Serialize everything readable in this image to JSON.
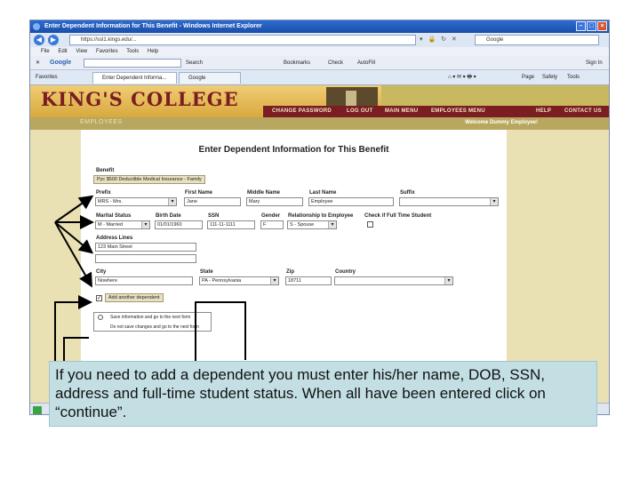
{
  "browser": {
    "window_title": "Enter Dependent Information for This Benefit - Windows Internet Explorer",
    "url": "https://ssl1.kings.edu/...",
    "search_engine": "Google",
    "menu": [
      "File",
      "Edit",
      "View",
      "Favorites",
      "Tools",
      "Help"
    ],
    "gtoolbar": {
      "logo": "Google",
      "search_label": "Search",
      "bookmarks": "Bookmarks",
      "check": "Check",
      "autofill": "AutoFill",
      "signin": "Sign In"
    },
    "tabs": {
      "favorites": "Favorites",
      "tab1": "Enter Dependent Informa...",
      "tab2": "Google"
    },
    "toolbar_right": {
      "page": "Page",
      "safety": "Safety",
      "tools": "Tools"
    }
  },
  "site": {
    "logo": "KING'S COLLEGE",
    "nav": [
      "CHANGE PASSWORD",
      "LOG OUT",
      "MAIN MENU",
      "EMPLOYEES MENU",
      "HELP",
      "CONTACT US"
    ],
    "section": "EMPLOYEES",
    "welcome": "Welcome Dummy Employee!"
  },
  "form": {
    "title": "Enter Dependent Information for This Benefit",
    "benefit_label": "Benefit",
    "benefit_value": "Pyc $500 Deductible Medical Insurance - Family",
    "prefix_label": "Prefix",
    "prefix_value": "MRS - Mrs.",
    "first_label": "First Name",
    "first_value": "Jane",
    "middle_label": "Middle Name",
    "middle_value": "Mary",
    "last_label": "Last Name",
    "last_value": "Employee",
    "suffix_label": "Suffix",
    "suffix_value": "",
    "marital_label": "Marital Status",
    "marital_value": "M - Married",
    "dob_label": "Birth Date",
    "dob_value": "01/01/1960",
    "ssn_label": "SSN",
    "ssn_value": "111-11-1111",
    "gender_label": "Gender",
    "gender_value": "F",
    "relationship_label": "Relationship to Employee",
    "relationship_value": "S - Spouse",
    "fulltime_label": "Check if Full Time Student",
    "address_label": "Address Lines",
    "address1_value": "123 Main Street",
    "address2_value": "",
    "city_label": "City",
    "city_value": "Nowhere",
    "state_label": "State",
    "state_value": "PA - Pennsylvania",
    "zip_label": "Zip",
    "zip_value": "18711",
    "country_label": "Country",
    "country_value": "",
    "add_another_label": "Add another dependent",
    "option_save": "Save information and go to the next form",
    "option_nosave": "Do not save changes and go to the next form"
  },
  "caption": "If you need to add a dependent you must enter his/her name, DOB, SSN, address and full-time student status.  When all have been entered click on “continue”."
}
